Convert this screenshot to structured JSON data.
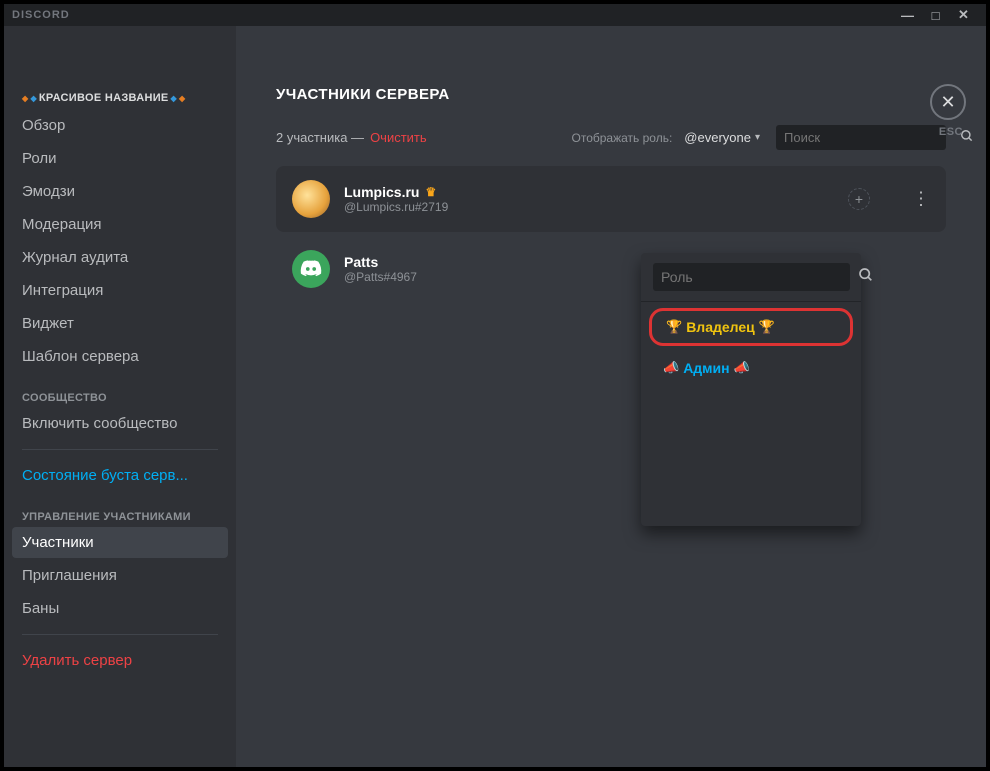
{
  "titlebar": {
    "app_name": "DISCORD"
  },
  "sidebar": {
    "server_name": "КРАСИВОЕ НАЗВАНИЕ",
    "items_top": [
      {
        "label": "Обзор"
      },
      {
        "label": "Роли"
      },
      {
        "label": "Эмодзи"
      },
      {
        "label": "Модерация"
      },
      {
        "label": "Журнал аудита"
      },
      {
        "label": "Интеграция"
      },
      {
        "label": "Виджет"
      },
      {
        "label": "Шаблон сервера"
      }
    ],
    "section_community": "СООБЩЕСТВО",
    "community_enable": "Включить сообщество",
    "boost_status": "Состояние буста серв...",
    "section_members": "УПРАВЛЕНИЕ УЧАСТНИКАМИ",
    "items_manage": [
      {
        "label": "Участники"
      },
      {
        "label": "Приглашения"
      },
      {
        "label": "Баны"
      }
    ],
    "delete_server": "Удалить сервер"
  },
  "main": {
    "title": "УЧАСТНИКИ СЕРВЕРА",
    "count_text": "2 участника —",
    "clear_text": "Очистить",
    "role_filter_label": "Отображать роль:",
    "role_filter_value": "@everyone",
    "search_placeholder": "Поиск",
    "close_label": "ESC",
    "members": [
      {
        "name": "Lumpics.ru",
        "tag": "@Lumpics.ru#2719",
        "owner": true
      },
      {
        "name": "Patts",
        "tag": "@Patts#4967",
        "owner": false
      }
    ]
  },
  "role_popout": {
    "search_placeholder": "Роль",
    "options": [
      {
        "label": "Владелец",
        "kind": "owner"
      },
      {
        "label": "Админ",
        "kind": "admin"
      }
    ]
  }
}
